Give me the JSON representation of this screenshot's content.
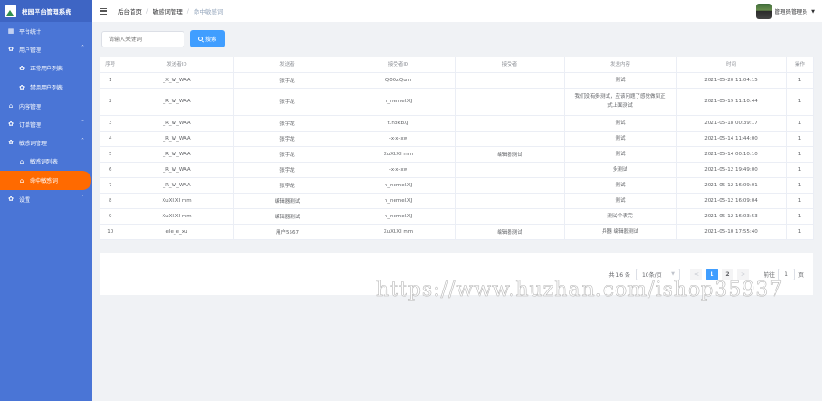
{
  "sidebar": {
    "title": "校园平台管理系统",
    "items": [
      {
        "label": "平台统计",
        "icon": "dashboard-icon",
        "level": 1,
        "arrow": ""
      },
      {
        "label": "用户管理",
        "icon": "gear-icon",
        "level": 1,
        "arrow": "^"
      },
      {
        "label": "正常用户列表",
        "icon": "gear-icon",
        "level": 2,
        "arrow": ""
      },
      {
        "label": "禁用用户列表",
        "icon": "gear-icon",
        "level": 2,
        "arrow": ""
      },
      {
        "label": "内容管理",
        "icon": "home-icon",
        "level": 1,
        "arrow": ""
      },
      {
        "label": "订单管理",
        "icon": "gear-icon",
        "level": 1,
        "arrow": "v"
      },
      {
        "label": "敏感词管理",
        "icon": "gear-icon",
        "level": 1,
        "arrow": "^"
      },
      {
        "label": "敏感词列表",
        "icon": "home-icon",
        "level": 2,
        "arrow": ""
      },
      {
        "label": "命中敏感词",
        "icon": "home-icon",
        "level": 2,
        "arrow": "",
        "active": true
      },
      {
        "label": "设置",
        "icon": "gear-icon",
        "level": 1,
        "arrow": "v"
      }
    ]
  },
  "header": {
    "breadcrumb": [
      "后台首页",
      "敏感词管理",
      "命中敏感词"
    ],
    "separator": "/",
    "username": "管理员管理员"
  },
  "search": {
    "placeholder": "请输入关键词",
    "button_label": "搜索"
  },
  "table": {
    "columns": [
      "序号",
      "发送者ID",
      "发送者",
      "接受者ID",
      "接受者",
      "发送内容",
      "时间",
      "操作"
    ],
    "rows": [
      [
        "1",
        "_X_W_WAA",
        "张宇龙",
        "Q0OzQum",
        "",
        "测试",
        "2021-05-20 11:04:15",
        "1"
      ],
      [
        "2",
        "_R_W_WAA",
        "张宇龙",
        "n_nemel.XJ",
        "",
        "我们没有多测试，应该问题了感觉做到正式上面测试",
        "2021-05-19 11:10:44",
        "1"
      ],
      [
        "3",
        "_R_W_WAA",
        "张宇龙",
        "t.nbkbXJ",
        "",
        "测试",
        "2021-05-18 00:39:17",
        "1"
      ],
      [
        "4",
        "_R_W_WAA",
        "张宇龙",
        "-x-x-xw",
        "",
        "测试",
        "2021-05-14 11:44:00",
        "1"
      ],
      [
        "5",
        "_R_W_WAA",
        "张宇龙",
        "XuXI.XI mm",
        "编辑器测试",
        "测试",
        "2021-05-14 00:10:10",
        "1"
      ],
      [
        "6",
        "_R_W_WAA",
        "张宇龙",
        "-x-x-xw",
        "",
        "多测试",
        "2021-05-12 19:49:00",
        "1"
      ],
      [
        "7",
        "_R_W_WAA",
        "张宇龙",
        "n_nemel.XJ",
        "",
        "测试",
        "2021-05-12 16:09:01",
        "1"
      ],
      [
        "8",
        "XuXI.XI mm",
        "编辑器测试",
        "n_nemel.XJ",
        "",
        "测试",
        "2021-05-12 16:09:04",
        "1"
      ],
      [
        "9",
        "XuXI.XI mm",
        "编辑器测试",
        "n_nemel.XJ",
        "",
        "测试个表完",
        "2021-05-12 16:03:53",
        "1"
      ],
      [
        "10",
        "ele_e_xu",
        "用户5567",
        "XuXI.XI mm",
        "编辑器测试",
        "兵器 编辑器测试",
        "2021-05-10 17:55:40",
        "1"
      ]
    ]
  },
  "pagination": {
    "total": "共 16 条",
    "page_size": "10条/页",
    "prev": "<",
    "pages": [
      "1",
      "2"
    ],
    "current": "1",
    "next": ">",
    "goto_label": "前往",
    "goto_value": "1",
    "goto_suffix": "页"
  },
  "watermark": "https://www.huzhan.com/ishop35937",
  "colors": {
    "sidebar": "#4a75d6",
    "active": "#ff6a00",
    "primary": "#409eff"
  }
}
